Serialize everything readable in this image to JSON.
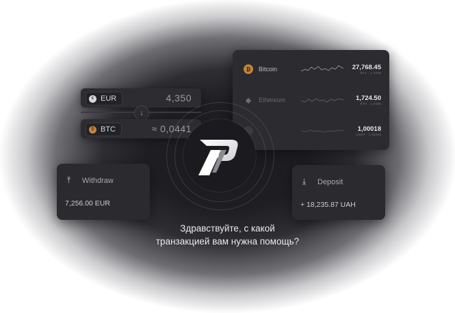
{
  "crypto_list": [
    {
      "name": "Bitcoin",
      "value": "27,768.45",
      "sub": "BTC · 1.2048",
      "symbol": "₿",
      "color": "#c7843a",
      "name_color": "#bdbdc2"
    },
    {
      "name": "Ethereum",
      "value": "1,724.50",
      "sub": "ETH · 1.0486",
      "symbol": "◆",
      "color": "#6e6e74",
      "name_color": "#6a6a70"
    },
    {
      "name": "",
      "value": "1,00018",
      "sub": "USDT · 1.00018",
      "symbol": "",
      "color": "#3a3a40",
      "name_color": "#6a6a70"
    }
  ],
  "exchange": {
    "from": {
      "currency": "EUR",
      "amount": "4,350",
      "icon": "euro-icon"
    },
    "to": {
      "currency": "BTC",
      "amount": "≈ 0,0441",
      "icon": "bitcoin-icon"
    },
    "swap_icon": "arrow-down-icon"
  },
  "withdraw": {
    "label": "Withdraw",
    "amount": "7,256.00 EUR",
    "icon": "upload-icon"
  },
  "deposit": {
    "label": "Deposit",
    "amount": "+ 18,235.87 UAH",
    "icon": "download-icon"
  },
  "greeting": {
    "line1": "Здравствуйте, с какой",
    "line2": "транзакцией вам нужна помощь?"
  },
  "colors": {
    "card_bg": "#2a2a2f",
    "bitcoin": "#c7843a",
    "text": "#ececee"
  }
}
